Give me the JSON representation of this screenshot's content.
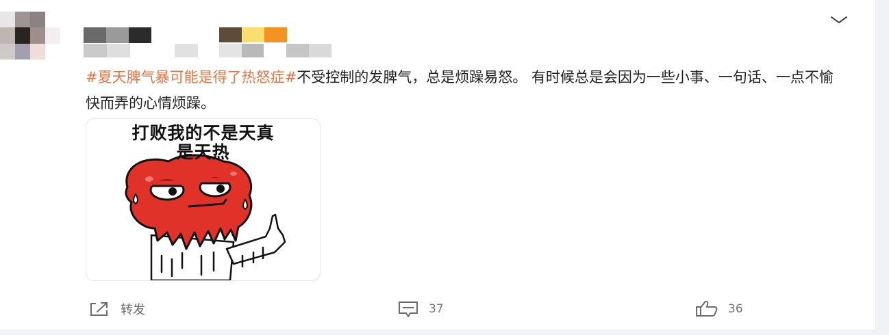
{
  "post": {
    "hashtag": "#夏天脾气暴可能是得了热怒症#",
    "text": "不受控制的发脾气，总是烦躁易怒。 有时候总是会因为一些小事、一句话、一点不愉快而弄的心情烦躁。"
  },
  "image": {
    "caption_line1": "打败我的不是天真",
    "caption_line2": "是天热"
  },
  "actions": {
    "repost_label": "转发",
    "comment_count": "37",
    "like_count": "36"
  },
  "icons": {
    "more": "chevron-down-icon",
    "repost": "share-icon",
    "comment": "comment-icon",
    "like": "thumbs-up-icon"
  },
  "colors": {
    "hashtag": "#eb7340",
    "text": "#222222",
    "muted": "#6b6b6b"
  }
}
